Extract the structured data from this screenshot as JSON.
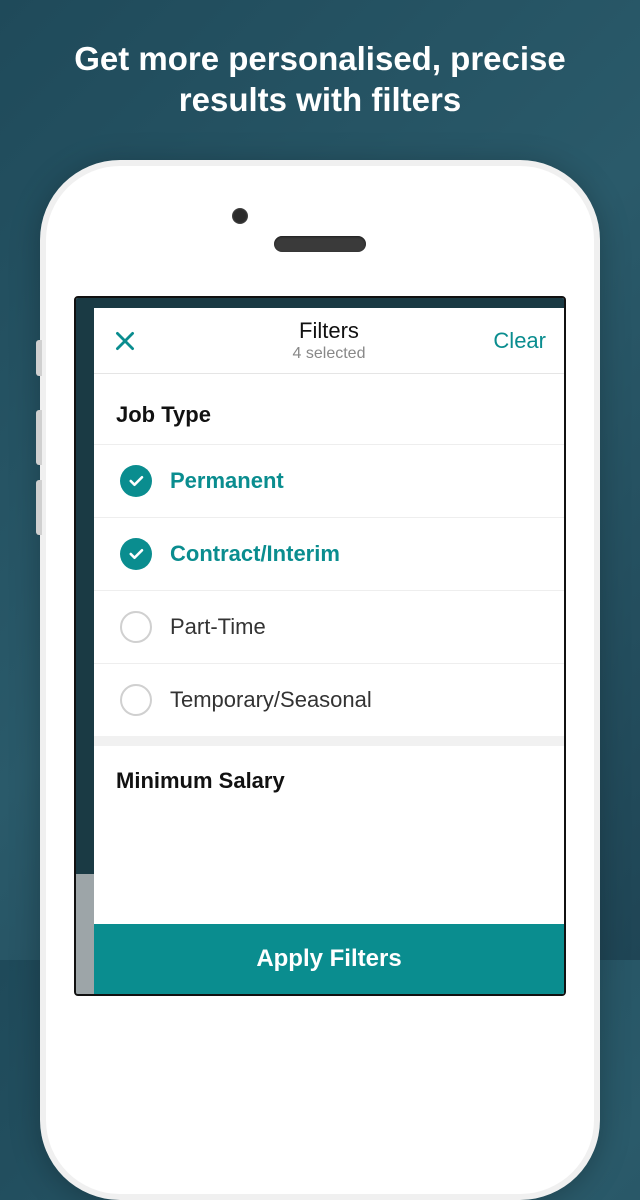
{
  "promo": {
    "headline": "Get more personalised, precise results with filters"
  },
  "navbar": {
    "title": "Filters",
    "subtitle": "4 selected",
    "clear_label": "Clear"
  },
  "sections": {
    "job_type": {
      "heading": "Job Type",
      "options": [
        {
          "label": "Permanent",
          "selected": true
        },
        {
          "label": "Contract/Interim",
          "selected": true
        },
        {
          "label": "Part-Time",
          "selected": false
        },
        {
          "label": "Temporary/Seasonal",
          "selected": false
        }
      ]
    },
    "minimum_salary": {
      "heading": "Minimum Salary"
    }
  },
  "footer": {
    "apply_label": "Apply Filters"
  },
  "colors": {
    "accent": "#0a8d8f"
  }
}
